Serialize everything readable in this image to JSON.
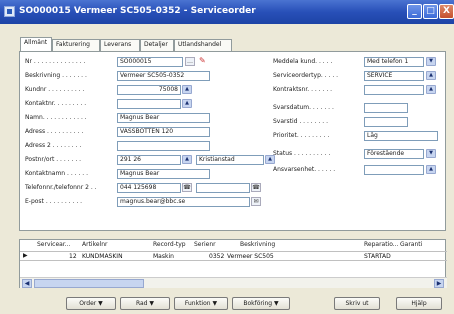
{
  "window": {
    "title": "SO000015 Vermeer SC505-0352 - Serviceorder",
    "controls": [
      "_",
      "□",
      "X"
    ]
  },
  "tabs": [
    "Allmänt",
    "Fakturering",
    "Leverans",
    "Detaljer",
    "Utlandshandel"
  ],
  "left_fields": [
    {
      "label": "Nr . . . . . . . . . . . . . .",
      "value": "SO000015"
    },
    {
      "label": "Beskrivning . . . . . . .",
      "value": "Vermeer SC505-0352"
    },
    {
      "label": "Kundnr . . . . . . . . . .",
      "value": "75008"
    },
    {
      "label": "Kontaktnr. . . . . . . . .",
      "value": ""
    },
    {
      "label": "Namn. . . . . . . . . . . .",
      "value": "Magnus Bear"
    },
    {
      "label": "Adress . . . . . . . . . .",
      "value": "VASSBOTTEN 120"
    },
    {
      "label": "Adress 2 . . . . . . . .",
      "value": ""
    },
    {
      "label": "Postnr/ort . . . . . . .",
      "value": "291 26",
      "value2": "Kristianstad"
    },
    {
      "label": "Kontaktnamn . . . . . .",
      "value": "Magnus Bear"
    },
    {
      "label": "Telefonnr./telefonnr 2 . .",
      "value": "044 125698"
    },
    {
      "label": "E-post . . . . . . . . . .",
      "value": "magnus.bear@bbc.se"
    }
  ],
  "right_fields": [
    {
      "label": "Meddela kund. . . . .",
      "value": "Med telefon 1"
    },
    {
      "label": "Serviceordertyp. . . . .",
      "value": "SERVICE"
    },
    {
      "label": "Kontraktsnr. . . . . . .",
      "value": ""
    },
    {
      "label": "Svarsdatum. . . . . . .",
      "value": ""
    },
    {
      "label": "Svarstid . . . . . . . .",
      "value": ""
    },
    {
      "label": "Prioritet. . . . . . . . .",
      "value": "Låg"
    },
    {
      "label": "Status . . . . . . . . . .",
      "value": "Förestående"
    },
    {
      "label": "Ansvarsenhet. . . . . .",
      "value": ""
    }
  ],
  "lines": {
    "headers": [
      "Servicear...",
      "Artikelnr",
      "Record-typ",
      "Serienr",
      "Beskrivning",
      "Reparatio...",
      "Garanti"
    ],
    "row": [
      "12",
      "KUNDMASKIN",
      "Maskin",
      "0352",
      "Vermeer SC505",
      "STARTAD",
      ""
    ]
  },
  "buttons": [
    "Order",
    "Rad",
    "Funktion",
    "Bokföring",
    "Skriv ut",
    "Hjälp"
  ]
}
